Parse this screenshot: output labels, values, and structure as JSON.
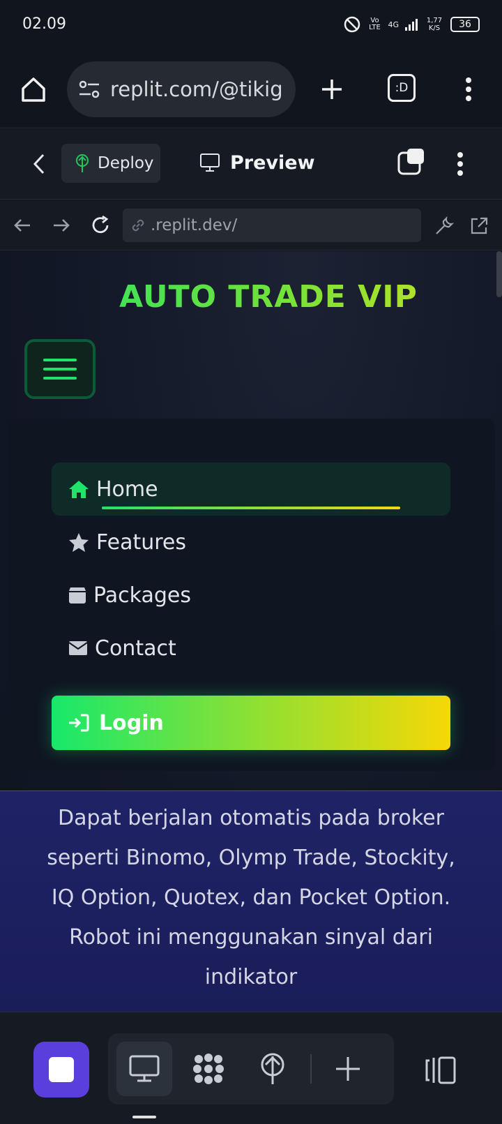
{
  "status": {
    "time": "02.09",
    "network": "4G",
    "volte": "Vo LTE",
    "speed": "1,77 K/S",
    "battery": "36"
  },
  "browser": {
    "url": "replit.com/@tikig"
  },
  "replit": {
    "deploy": "Deploy",
    "preview": "Preview"
  },
  "devtools": {
    "url": ".replit.dev/"
  },
  "site": {
    "brand": "AUTO TRADE VIP",
    "nav": [
      {
        "label": "Home",
        "active": true
      },
      {
        "label": "Features"
      },
      {
        "label": "Packages"
      },
      {
        "label": "Contact"
      }
    ],
    "login": "Login",
    "description": "Dapat berjalan otomatis pada broker seperti Binomo, Olymp Trade, Stockity, IQ Option, Quotex, dan Pocket Option. Robot ini menggunakan sinyal dari indikator"
  },
  "colors": {
    "accent_green": "#22e36a",
    "accent_yellow": "#f6d806",
    "replit_purple": "#5b3fdc"
  }
}
